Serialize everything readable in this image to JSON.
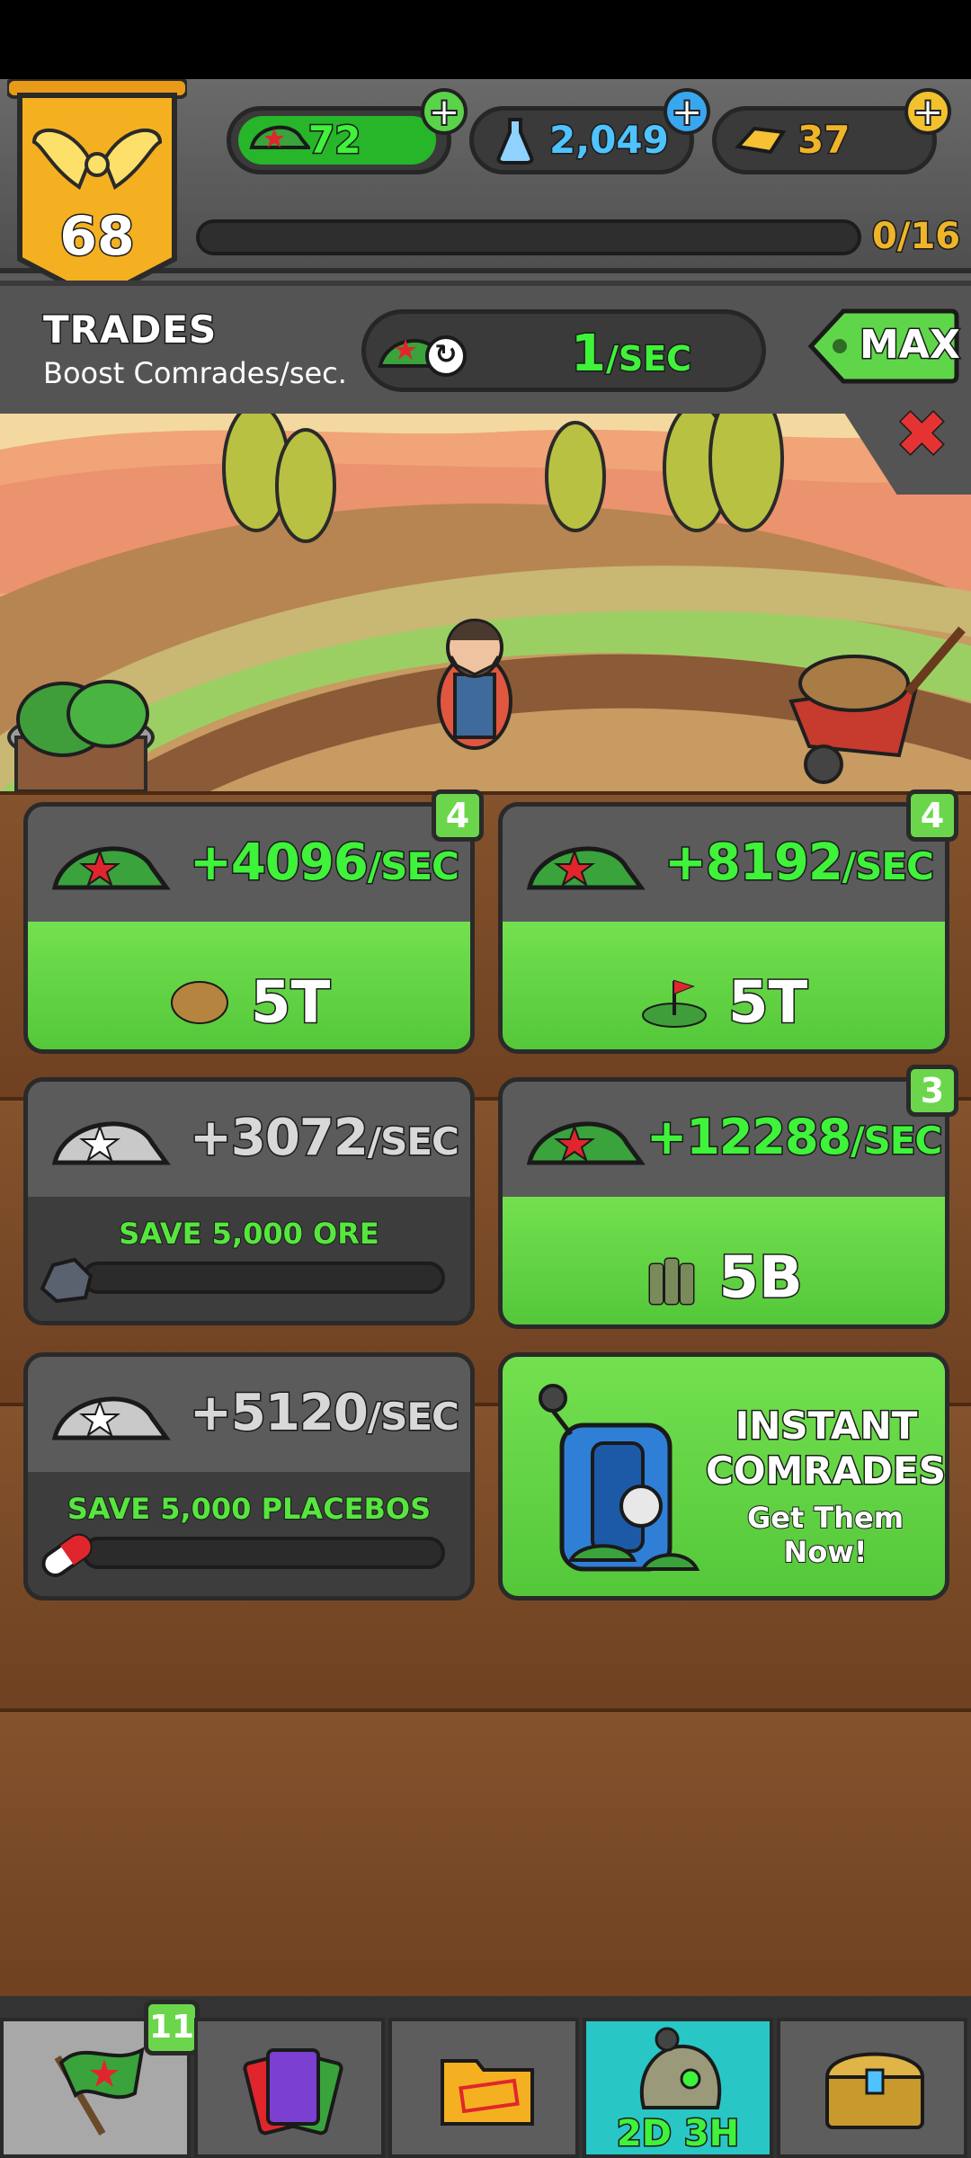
{
  "player": {
    "level": "68"
  },
  "currencies": [
    {
      "name": "comrades",
      "value": "72",
      "icon": "army-cap-icon"
    },
    {
      "name": "science",
      "value": "2,049",
      "icon": "flask-icon"
    },
    {
      "name": "gold",
      "value": "37",
      "icon": "gold-bars-icon"
    }
  ],
  "progress": {
    "text": "0/16",
    "fraction": 0
  },
  "trades": {
    "title": "TRADES",
    "subtitle": "Boost Comrades/sec.",
    "rate_value": "1",
    "rate_unit": "/SEC",
    "max_label": "MAX"
  },
  "cards": [
    {
      "rate": "+4096",
      "unit": "/SEC",
      "badge": "4",
      "cost": "5T",
      "cost_icon": "potato-icon",
      "state": "active"
    },
    {
      "rate": "+8192",
      "unit": "/SEC",
      "badge": "4",
      "cost": "5T",
      "cost_icon": "land-flag-icon",
      "state": "active"
    },
    {
      "rate": "+3072",
      "unit": "/SEC",
      "badge": "",
      "save_text": "SAVE 5,000 ORE",
      "save_icon": "ore-icon",
      "state": "locked",
      "progress": 0
    },
    {
      "rate": "+12288",
      "unit": "/SEC",
      "badge": "3",
      "cost": "5B",
      "cost_icon": "bullets-icon",
      "state": "active"
    },
    {
      "rate": "+5120",
      "unit": "/SEC",
      "badge": "",
      "save_text": "SAVE 5,000 PLACEBOS",
      "save_icon": "pill-icon",
      "state": "locked",
      "progress": 0
    }
  ],
  "promo": {
    "line1": "INSTANT",
    "line2": "COMRADES!",
    "line3": "Get Them Now!"
  },
  "nav": {
    "badge": "11",
    "timer": "2D 3H"
  },
  "colors": {
    "accent_green": "#3ff23a",
    "gold": "#f0b429",
    "panel": "#545454"
  }
}
